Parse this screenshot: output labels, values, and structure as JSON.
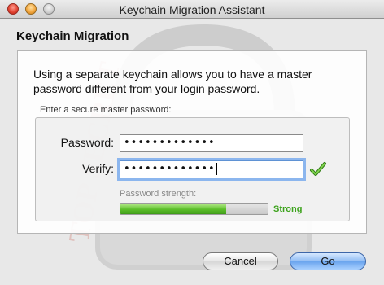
{
  "window": {
    "title": "Keychain Migration Assistant",
    "traffic_icons": [
      "close-icon",
      "minimize-icon",
      "zoom-icon"
    ]
  },
  "dialog": {
    "heading": "Keychain Migration",
    "intro_text": "Using a separate keychain allows you to have a master password different from your login password.",
    "group_label": "Enter a secure master password:",
    "password_label": "Password:",
    "password_value": "•••••••••••••",
    "verify_label": "Verify:",
    "verify_value": "•••••••••••••",
    "verify_status_icon": "checkmark-icon",
    "strength_label": "Password strength:",
    "strength_text": "Strong",
    "strength_fraction": 0.72
  },
  "buttons": {
    "cancel": "Cancel",
    "go": "Go"
  },
  "colors": {
    "strong": "#3ca21c",
    "accent": "#6aa4ee"
  }
}
